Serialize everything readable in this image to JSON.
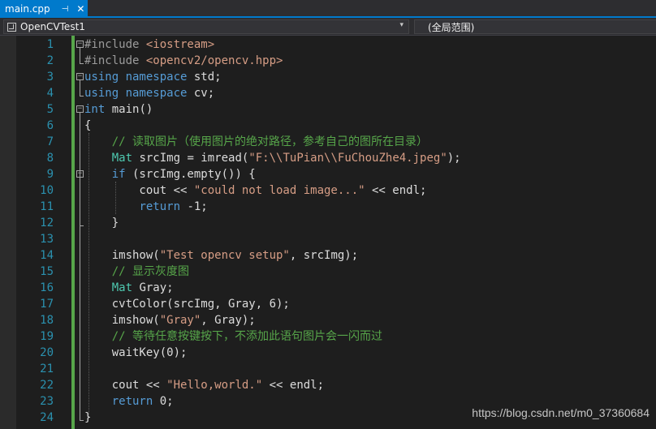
{
  "tab": {
    "title": "main.cpp",
    "pin": "⊣",
    "close": "✕"
  },
  "navbar": {
    "project": "OpenCVTest1",
    "scope": "(全局范围)",
    "dropdown": "▾"
  },
  "lines": [
    {
      "n": "1",
      "parts": [
        {
          "t": "#include ",
          "c": "pp"
        },
        {
          "t": "<iostream>",
          "c": "inc"
        }
      ]
    },
    {
      "n": "2",
      "parts": [
        {
          "t": "#include ",
          "c": "pp"
        },
        {
          "t": "<opencv2/opencv.hpp>",
          "c": "inc"
        }
      ]
    },
    {
      "n": "3",
      "parts": [
        {
          "t": "using namespace",
          "c": "kw"
        },
        {
          "t": " std;",
          "c": ""
        }
      ]
    },
    {
      "n": "4",
      "parts": [
        {
          "t": "using namespace",
          "c": "kw"
        },
        {
          "t": " cv;",
          "c": ""
        }
      ]
    },
    {
      "n": "5",
      "parts": [
        {
          "t": "int",
          "c": "kw"
        },
        {
          "t": " main()",
          "c": ""
        }
      ]
    },
    {
      "n": "6",
      "parts": [
        {
          "t": "{",
          "c": ""
        }
      ]
    },
    {
      "n": "7",
      "parts": [
        {
          "t": "    // 读取图片（使用图片的绝对路径，参考自己的图所在目录）",
          "c": "cm"
        }
      ]
    },
    {
      "n": "8",
      "parts": [
        {
          "t": "    ",
          "c": ""
        },
        {
          "t": "Mat",
          "c": "ty"
        },
        {
          "t": " srcImg = imread(",
          "c": ""
        },
        {
          "t": "\"F:\\\\TuPian\\\\FuChouZhe4.jpeg\"",
          "c": "str"
        },
        {
          "t": ");",
          "c": ""
        }
      ]
    },
    {
      "n": "9",
      "parts": [
        {
          "t": "    ",
          "c": ""
        },
        {
          "t": "if",
          "c": "kw"
        },
        {
          "t": " (srcImg.empty()) {",
          "c": ""
        }
      ]
    },
    {
      "n": "10",
      "parts": [
        {
          "t": "        cout << ",
          "c": ""
        },
        {
          "t": "\"could not load image...\"",
          "c": "str"
        },
        {
          "t": " << endl;",
          "c": ""
        }
      ]
    },
    {
      "n": "11",
      "parts": [
        {
          "t": "        ",
          "c": ""
        },
        {
          "t": "return",
          "c": "kw"
        },
        {
          "t": " -1;",
          "c": ""
        }
      ]
    },
    {
      "n": "12",
      "parts": [
        {
          "t": "    }",
          "c": ""
        }
      ]
    },
    {
      "n": "13",
      "parts": [
        {
          "t": "",
          "c": ""
        }
      ]
    },
    {
      "n": "14",
      "parts": [
        {
          "t": "    imshow(",
          "c": ""
        },
        {
          "t": "\"Test opencv setup\"",
          "c": "str"
        },
        {
          "t": ", srcImg);",
          "c": ""
        }
      ]
    },
    {
      "n": "15",
      "parts": [
        {
          "t": "    // 显示灰度图",
          "c": "cm"
        }
      ]
    },
    {
      "n": "16",
      "parts": [
        {
          "t": "    ",
          "c": ""
        },
        {
          "t": "Mat",
          "c": "ty"
        },
        {
          "t": " Gray;",
          "c": ""
        }
      ]
    },
    {
      "n": "17",
      "parts": [
        {
          "t": "    cvtColor(srcImg, Gray, 6);",
          "c": ""
        }
      ]
    },
    {
      "n": "18",
      "parts": [
        {
          "t": "    imshow(",
          "c": ""
        },
        {
          "t": "\"Gray\"",
          "c": "str"
        },
        {
          "t": ", Gray);",
          "c": ""
        }
      ]
    },
    {
      "n": "19",
      "parts": [
        {
          "t": "    // 等待任意按键按下，不添加此语句图片会一闪而过",
          "c": "cm"
        }
      ]
    },
    {
      "n": "20",
      "parts": [
        {
          "t": "    waitKey(0);",
          "c": ""
        }
      ]
    },
    {
      "n": "21",
      "parts": [
        {
          "t": "",
          "c": ""
        }
      ]
    },
    {
      "n": "22",
      "parts": [
        {
          "t": "    cout << ",
          "c": ""
        },
        {
          "t": "\"Hello,world.\"",
          "c": "str"
        },
        {
          "t": " << endl;",
          "c": ""
        }
      ]
    },
    {
      "n": "23",
      "parts": [
        {
          "t": "    ",
          "c": ""
        },
        {
          "t": "return",
          "c": "kw"
        },
        {
          "t": " 0;",
          "c": ""
        }
      ]
    },
    {
      "n": "24",
      "parts": [
        {
          "t": "}",
          "c": ""
        }
      ]
    }
  ],
  "watermark": "https://blog.csdn.net/m0_37360684"
}
